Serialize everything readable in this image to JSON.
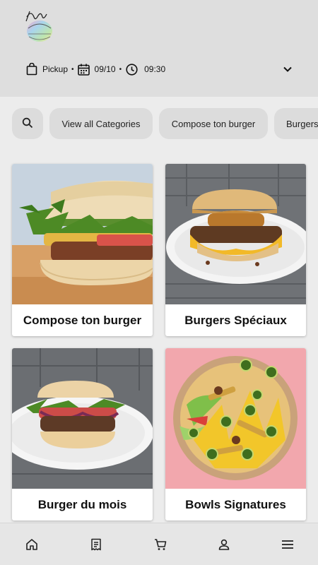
{
  "header": {
    "logo_alt": "burger logo",
    "order": {
      "mode": "Pickup",
      "date": "09/10",
      "time": "09:30",
      "separator": "•"
    }
  },
  "categories": {
    "search_icon": "search-icon",
    "chips": [
      {
        "label": "View all Categories"
      },
      {
        "label": "Compose ton burger"
      },
      {
        "label": "Burgers Spéciaux"
      }
    ]
  },
  "cards": [
    {
      "title": "Compose ton burger"
    },
    {
      "title": "Burgers Spéciaux"
    },
    {
      "title": "Burger du mois"
    },
    {
      "title": "Bowls Signatures"
    }
  ],
  "bottom_nav": {
    "items": [
      "home-icon",
      "receipt-icon",
      "cart-icon",
      "account-icon",
      "menu-icon"
    ]
  },
  "colors": {
    "header_bg": "#dedede",
    "page_bg": "#ececec",
    "chip_bg": "#dcdcdc",
    "nav_bg": "#e6e6e6"
  }
}
